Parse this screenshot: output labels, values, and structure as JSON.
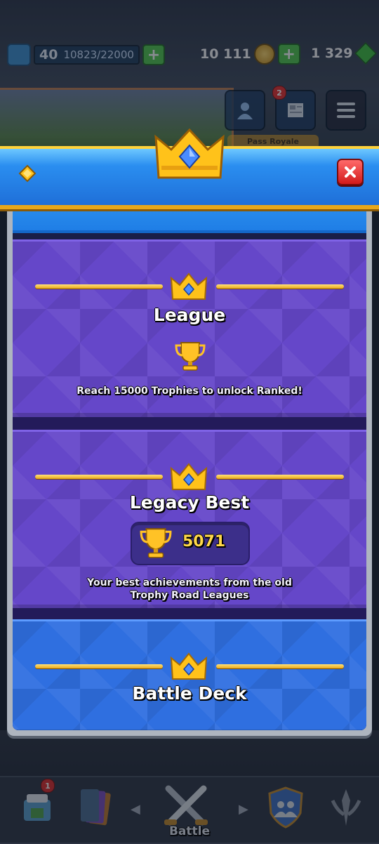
{
  "top_bar": {
    "level": "40",
    "xp": "10823/22000",
    "gold": "10 111",
    "gems": "1 329"
  },
  "top_buttons": {
    "news_badge": "2"
  },
  "background": {
    "pass_banner": "Pass Royale"
  },
  "modal": {
    "sections": {
      "league": {
        "title": "League",
        "description": "Reach 15000 Trophies to unlock Ranked!"
      },
      "legacy": {
        "title": "Legacy Best",
        "trophies": "5071",
        "description_line1": "Your best achievements from the old",
        "description_line2": "Trophy Road Leagues"
      },
      "deck": {
        "title": "Battle Deck"
      }
    }
  },
  "bottom_nav": {
    "shop_badge": "1",
    "battle_label": "Battle"
  },
  "colors": {
    "header_blue": "#1f6fd8",
    "section_purple": "#6547c9",
    "section_blue": "#2f6fe0",
    "gold": "#ffd84a",
    "close_red": "#d21a1a"
  }
}
